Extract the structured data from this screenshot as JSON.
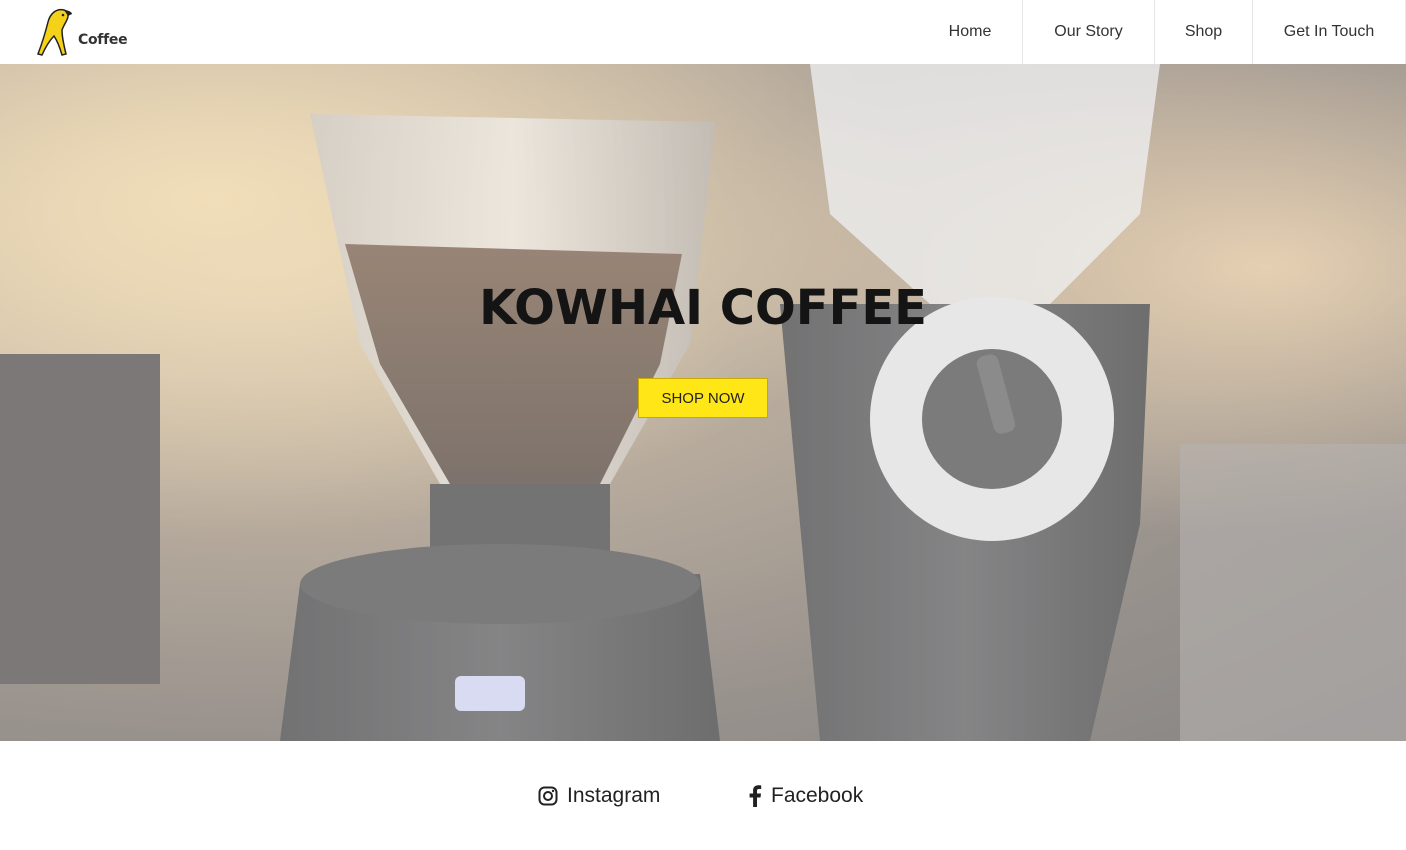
{
  "header": {
    "logo_text": "Coffee",
    "nav": [
      {
        "label": "Home"
      },
      {
        "label": "Our Story"
      },
      {
        "label": "Shop"
      },
      {
        "label": "Get In Touch"
      }
    ]
  },
  "hero": {
    "title": "KOWHAI COFFEE",
    "cta_label": "SHOP NOW"
  },
  "social": {
    "instagram_label": "Instagram",
    "facebook_label": "Facebook"
  },
  "icons": {
    "logo": "kowhai-bird-logo-icon",
    "instagram": "instagram-icon",
    "facebook": "facebook-icon"
  },
  "colors": {
    "accent": "#ffe617",
    "title": "#141414",
    "text": "#333333"
  }
}
